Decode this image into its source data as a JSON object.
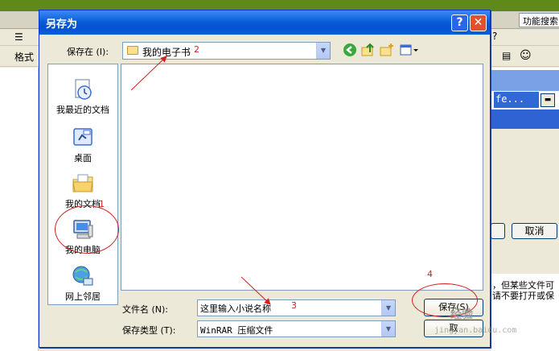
{
  "background_app": {
    "search_box": "功能搜索",
    "format_label": "格式",
    "filename_box": "fe...",
    "cancel_label": "取消",
    "warning_line1": "，但某些文件可",
    "warning_line2": "请不要打开或保",
    "question_mark": "?"
  },
  "dialog": {
    "title": "另存为",
    "help_label": "?",
    "close_label": "✕",
    "save_in_label": "保存在 (I):",
    "save_in_value": "我的电子书",
    "places": [
      {
        "label": "我最近的文档",
        "icon": "recent-documents-icon"
      },
      {
        "label": "桌面",
        "icon": "desktop-icon"
      },
      {
        "label": "我的文档",
        "icon": "my-documents-icon"
      },
      {
        "label": "我的电脑",
        "icon": "my-computer-icon"
      },
      {
        "label": "网上邻居",
        "icon": "network-places-icon"
      }
    ],
    "filename_label": "文件名 (N):",
    "filename_value": "这里输入小说名称",
    "filetype_label": "保存类型 (T):",
    "filetype_value": "WinRAR 压缩文件",
    "save_button": "保存(S)",
    "cancel_button": "取"
  },
  "annotations": {
    "n1": "1",
    "n2": "2",
    "n3": "3",
    "n4": "4",
    "color": "#d42020"
  },
  "watermark": {
    "text": "经验",
    "url": "jingyan.baidu.com"
  },
  "colors": {
    "titlebar": "#0a5fd8",
    "dialog_bg": "#ece9d8",
    "close_button": "#e0522d",
    "border": "#7f9db9"
  }
}
